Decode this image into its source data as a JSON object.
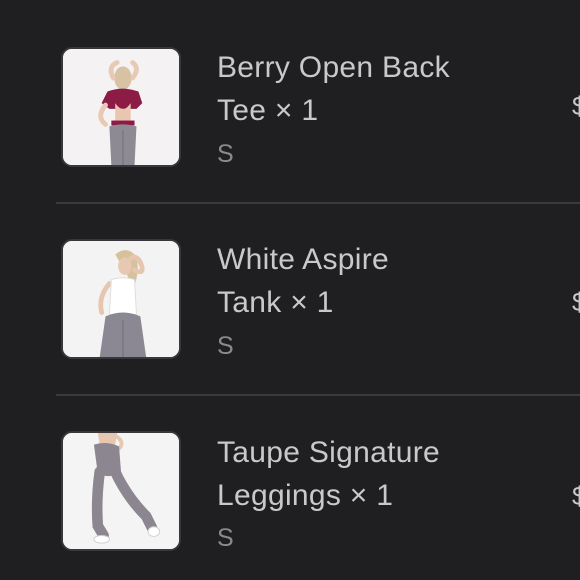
{
  "cart": {
    "items": [
      {
        "name_line1": "Berry Open Back",
        "name_line2": "Tee × 1",
        "size": "S",
        "price_fragment": "$",
        "thumbnail": "berry-tee-photo"
      },
      {
        "name_line1": "White Aspire",
        "name_line2": "Tank × 1",
        "size": "S",
        "price_fragment": "$",
        "thumbnail": "white-tank-photo"
      },
      {
        "name_line1": "Taupe Signature",
        "name_line2": "Leggings × 1",
        "size": "S",
        "price_fragment": "$",
        "thumbnail": "taupe-leggings-photo"
      }
    ]
  },
  "colors": {
    "background": "#1f1f22",
    "text_primary": "#c9c9cc",
    "text_secondary": "#8a8a8e",
    "divider": "#3a3a3e",
    "berry": "#8c1c45",
    "taupe": "#8f8a90"
  }
}
